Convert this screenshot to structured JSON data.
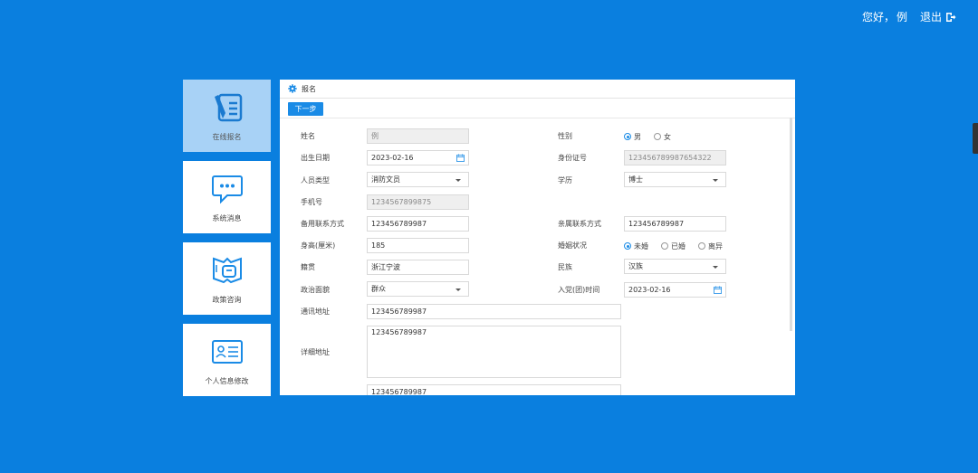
{
  "header": {
    "greeting": "您好，",
    "user": "例",
    "logout_label": "退出"
  },
  "sidebar": {
    "items": [
      {
        "label": "在线报名",
        "active": true
      },
      {
        "label": "系统消息"
      },
      {
        "label": "政策咨询"
      },
      {
        "label": "个人信息修改"
      }
    ]
  },
  "panel": {
    "title": "报名",
    "next_label": "下一步"
  },
  "form": {
    "name": {
      "label": "姓名",
      "value": "例"
    },
    "gender": {
      "label": "性别",
      "options": [
        "男",
        "女"
      ],
      "selected": "男"
    },
    "birth": {
      "label": "出生日期",
      "value": "2023-02-16"
    },
    "idcard": {
      "label": "身份证号",
      "value": "123456789987654322"
    },
    "person_type": {
      "label": "人员类型",
      "value": "消防文员"
    },
    "education": {
      "label": "学历",
      "value": "博士"
    },
    "phone": {
      "label": "手机号",
      "value": "1234567899875"
    },
    "backup_contact": {
      "label": "备用联系方式",
      "value": "123456789987"
    },
    "family_contact": {
      "label": "亲属联系方式",
      "value": "123456789987"
    },
    "height": {
      "label": "身高(厘米)",
      "value": "185"
    },
    "marital": {
      "label": "婚姻状况",
      "options": [
        "未婚",
        "已婚",
        "离异"
      ],
      "selected": "未婚"
    },
    "origin": {
      "label": "籍贯",
      "value": "浙江宁波"
    },
    "ethnicity": {
      "label": "民族",
      "value": "汉族"
    },
    "politics": {
      "label": "政治面貌",
      "value": "群众"
    },
    "party_date": {
      "label": "入党(团)时间",
      "value": "2023-02-16"
    },
    "mail_address": {
      "label": "通讯地址",
      "value": "123456789987"
    },
    "detail_address": {
      "label": "详细地址",
      "value": "123456789987"
    },
    "extra_field": {
      "value": "123456789987"
    }
  },
  "colors": {
    "background": "#0a7fdf",
    "accent": "#1a8be6",
    "active_card": "#a8d2f6"
  }
}
